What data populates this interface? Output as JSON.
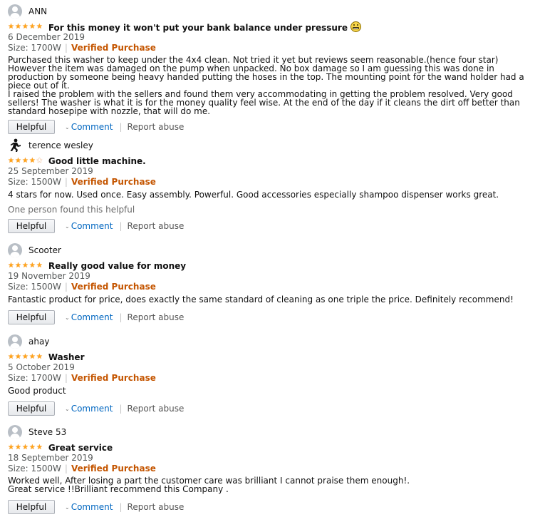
{
  "colors": {
    "star": "#ffa41c",
    "verified": "#c45500",
    "link": "#0066c0",
    "muted": "#565959"
  },
  "reviews": [
    {
      "author": "ANN",
      "avatar_icon": "default-avatar-icon",
      "rating": 5,
      "title": "For this money it won't put your bank balance under pressure",
      "title_emoji": "grimace-emoji-icon",
      "date": "6 December 2019",
      "size": "Size: 1700W",
      "verified": "Verified Purchase",
      "body": [
        "Purchased this washer to keep under the 4x4 clean. Not tried it yet but reviews seem reasonable.(hence four star) However the item was damaged on the pump when unpacked. No box damage so I am guessing this was done in production by someone being heavy handed putting the hoses in the top. The mounting point for the wand holder had a piece out of it.",
        "I raised the problem with the sellers and found them very accommodating in getting the problem resolved. Very good sellers! The washer is what it is for the money quality feel wise. At the end of the day if it cleans the dirt off better than standard hosepipe with nozzle, that will do me."
      ],
      "found_helpful": "",
      "helpful_label": "Helpful",
      "comment_label": "Comment",
      "report_label": "Report abuse"
    },
    {
      "author": "terence wesley",
      "avatar_icon": "runner-avatar-icon",
      "rating": 4,
      "title": "Good little machine.",
      "title_emoji": "",
      "date": "25 September 2019",
      "size": "Size: 1500W",
      "verified": "Verified Purchase",
      "body": [
        "4 stars for now. Used once. Easy assembly. Powerful. Good accessories especially shampoo dispenser works great."
      ],
      "found_helpful": "One person found this helpful",
      "helpful_label": "Helpful",
      "comment_label": "Comment",
      "report_label": "Report abuse"
    },
    {
      "author": "Scooter",
      "avatar_icon": "default-avatar-icon",
      "rating": 5,
      "title": "Really good value for money",
      "title_emoji": "",
      "date": "19 November 2019",
      "size": "Size: 1500W",
      "verified": "Verified Purchase",
      "body": [
        "Fantastic product for price, does exactly the same standard of cleaning as one triple the price. Definitely recommend!"
      ],
      "found_helpful": "",
      "helpful_label": "Helpful",
      "comment_label": "Comment",
      "report_label": "Report abuse"
    },
    {
      "author": "ahay",
      "avatar_icon": "default-avatar-icon",
      "rating": 5,
      "title": "Washer",
      "title_emoji": "",
      "date": "5 October 2019",
      "size": "Size: 1700W",
      "verified": "Verified Purchase",
      "body": [
        "Good product"
      ],
      "found_helpful": "",
      "helpful_label": "Helpful",
      "comment_label": "Comment",
      "report_label": "Report abuse"
    },
    {
      "author": "Steve 53",
      "avatar_icon": "default-avatar-icon",
      "rating": 5,
      "title": "Great service",
      "title_emoji": "",
      "date": "18 September 2019",
      "size": "Size: 1500W",
      "verified": "Verified Purchase",
      "body": [
        "Worked well, After losing a part the customer care was brilliant I cannot praise them enough!.",
        "Great service !!Brilliant recommend this Company ."
      ],
      "found_helpful": "",
      "helpful_label": "Helpful",
      "comment_label": "Comment",
      "report_label": "Report abuse"
    }
  ]
}
